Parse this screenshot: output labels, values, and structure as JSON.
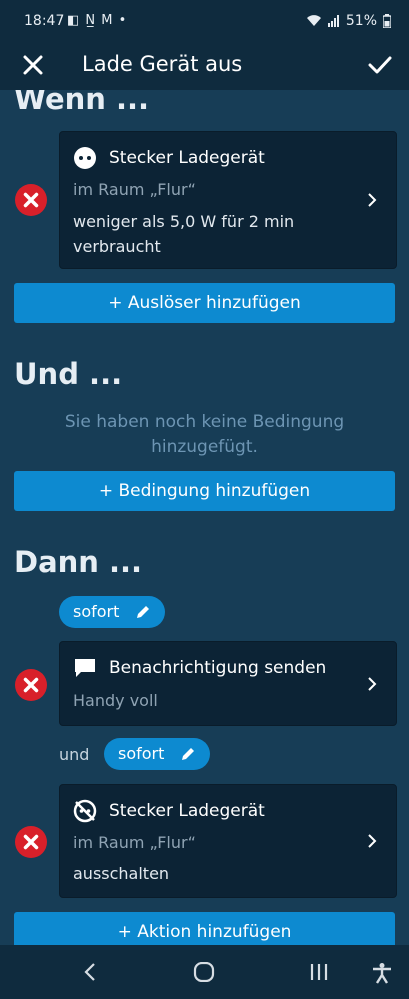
{
  "status": {
    "time": "18:47",
    "notif_icons": "◧ N̲ M •",
    "battery": "51%"
  },
  "header": {
    "title": "Lade Gerät aus"
  },
  "when": {
    "heading": "Wenn ...",
    "trigger": {
      "device": "Stecker Ladegerät",
      "room": "im Raum „Flur“",
      "condition": "weniger als 5,0 W für 2 min verbraucht"
    },
    "add_label": "+ Auslöser hinzufügen"
  },
  "and": {
    "heading": "Und ...",
    "empty_text": "Sie haben noch keine Bedingung hinzugefügt.",
    "add_label": "+ Bedingung hinzufügen"
  },
  "then": {
    "heading": "Dann ...",
    "timing1": "sofort",
    "action1": {
      "title": "Benachrichtigung senden",
      "detail": "Handy voll"
    },
    "connector": "und",
    "timing2": "sofort",
    "action2": {
      "device": "Stecker Ladegerät",
      "room": "im Raum „Flur“",
      "detail": "ausschalten"
    },
    "add_label": "+ Aktion hinzufügen"
  }
}
